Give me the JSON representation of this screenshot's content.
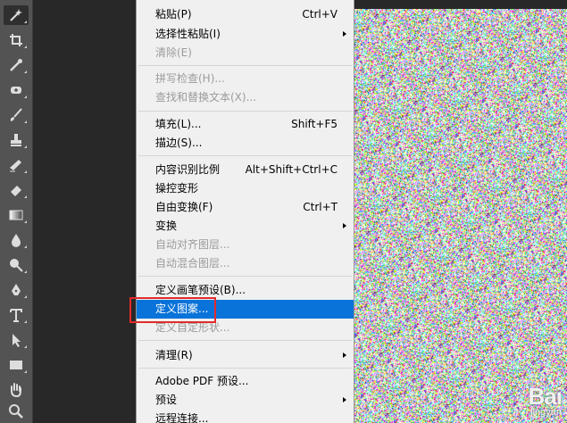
{
  "menu": {
    "items": [
      {
        "label": "粘贴(P)",
        "shortcut": "Ctrl+V",
        "disabled": false
      },
      {
        "label": "选择性粘贴(I)",
        "submenu": true,
        "disabled": false
      },
      {
        "label": "清除(E)",
        "disabled": true
      },
      {
        "label": "拼写检查(H)...",
        "disabled": true
      },
      {
        "label": "查找和替换文本(X)...",
        "disabled": true
      },
      {
        "label": "填充(L)...",
        "shortcut": "Shift+F5",
        "disabled": false
      },
      {
        "label": "描边(S)...",
        "disabled": false
      },
      {
        "label": "内容识别比例",
        "shortcut": "Alt+Shift+Ctrl+C",
        "disabled": false
      },
      {
        "label": "操控变形",
        "disabled": false
      },
      {
        "label": "自由变换(F)",
        "shortcut": "Ctrl+T",
        "disabled": false
      },
      {
        "label": "变换",
        "submenu": true,
        "disabled": false
      },
      {
        "label": "自动对齐图层...",
        "disabled": true
      },
      {
        "label": "自动混合图层...",
        "disabled": true
      },
      {
        "label": "定义画笔预设(B)...",
        "disabled": false
      },
      {
        "label": "定义图案...",
        "highlighted": true,
        "disabled": false
      },
      {
        "label": "定义自定形状...",
        "disabled": true
      },
      {
        "label": "清理(R)",
        "submenu": true,
        "disabled": false
      },
      {
        "label": "Adobe PDF 预设...",
        "disabled": false
      },
      {
        "label": "预设",
        "submenu": true,
        "disabled": false
      },
      {
        "label": "远程连接...",
        "disabled": false
      }
    ]
  },
  "toolbox": {
    "tools": [
      {
        "icon": "magic-wand-icon"
      },
      {
        "icon": "crop-icon"
      },
      {
        "icon": "eyedropper-icon"
      },
      {
        "icon": "healing-brush-icon"
      },
      {
        "icon": "brush-icon"
      },
      {
        "icon": "clone-stamp-icon"
      },
      {
        "icon": "history-brush-icon"
      },
      {
        "icon": "eraser-icon"
      },
      {
        "icon": "gradient-icon"
      },
      {
        "icon": "blur-icon"
      },
      {
        "icon": "dodge-icon"
      },
      {
        "icon": "pen-icon"
      },
      {
        "icon": "type-icon"
      },
      {
        "icon": "path-selection-icon"
      },
      {
        "icon": "rectangle-icon"
      },
      {
        "icon": "hand-icon"
      },
      {
        "icon": "zoom-icon"
      }
    ]
  },
  "watermark": {
    "text": "Bai",
    "sub": "jingyan"
  },
  "colors": {
    "highlight": "#0a73d9",
    "annotation": "#e32b2b",
    "menu_bg": "#f0f0f0",
    "toolbox_bg": "#535353"
  }
}
